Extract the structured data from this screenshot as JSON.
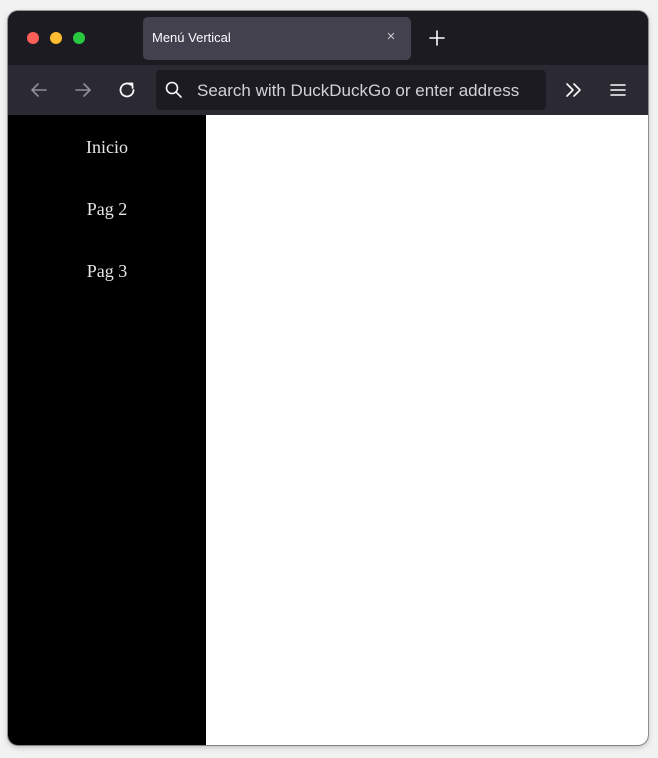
{
  "browser": {
    "tab": {
      "title": "Menú Vertical",
      "close_glyph": "×"
    },
    "new_tab_icon": "plus-icon",
    "nav": {
      "back_icon": "arrow-left-icon",
      "forward_icon": "arrow-right-icon",
      "reload_icon": "reload-icon",
      "overflow_icon": "chevron-double-right-icon",
      "menu_icon": "hamburger-menu-icon"
    },
    "urlbar": {
      "placeholder": "Search with DuckDuckGo or enter address",
      "icon": "search-icon"
    },
    "colors": {
      "tabstrip": "#1c1b22",
      "active_tab": "#42414d",
      "navbar": "#2b2a33",
      "urlbar": "#1c1b22"
    }
  },
  "page": {
    "sidebar": {
      "background": "#000000",
      "items": [
        {
          "label": "Inicio"
        },
        {
          "label": "Pag 2"
        },
        {
          "label": "Pag 3"
        }
      ]
    },
    "main_background": "#ffffff"
  }
}
